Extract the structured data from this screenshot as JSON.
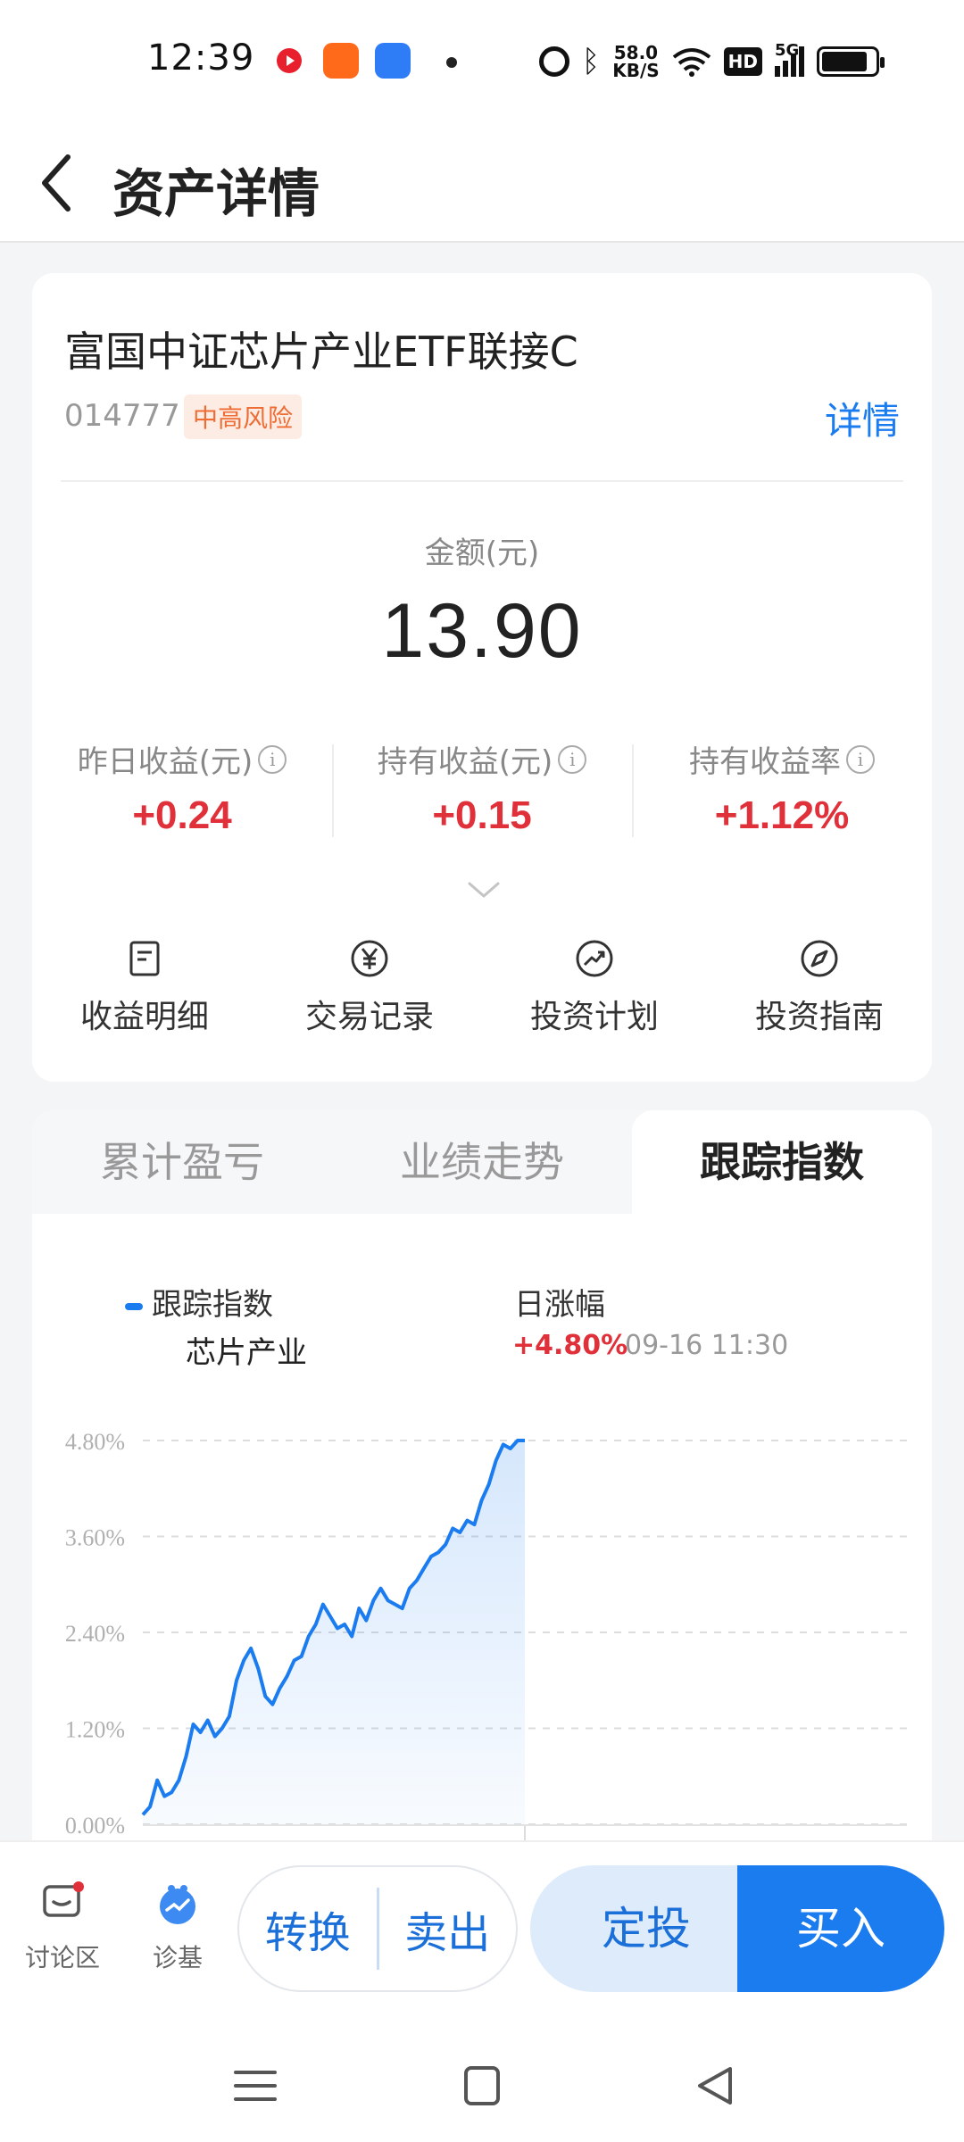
{
  "status_bar": {
    "time": "12:39",
    "net_speed_value": "58.0",
    "net_speed_unit": "KB/S",
    "hd": "HD",
    "signal": "5G",
    "icons": [
      "video-app-icon",
      "kuaishou-app-icon",
      "baidu-app-icon",
      "dot-icon",
      "alarm-icon",
      "bluetooth-icon",
      "wifi-icon",
      "hd-icon",
      "signal-icon",
      "battery-icon"
    ]
  },
  "header": {
    "title": "资产详情"
  },
  "fund": {
    "name": "富国中证芯片产业ETF联接C",
    "code": "014777",
    "risk": "中高风险",
    "detail_link": "详情",
    "amount_label": "金额(元)",
    "amount_value": "13.90"
  },
  "stats": [
    {
      "label": "昨日收益(元)",
      "value": "+0.24"
    },
    {
      "label": "持有收益(元)",
      "value": "+0.15"
    },
    {
      "label": "持有收益率",
      "value": "+1.12%"
    }
  ],
  "actions": [
    {
      "label": "收益明细",
      "icon": "document-icon"
    },
    {
      "label": "交易记录",
      "icon": "yuan-icon"
    },
    {
      "label": "投资计划",
      "icon": "trend-icon"
    },
    {
      "label": "投资指南",
      "icon": "compass-icon"
    }
  ],
  "tabs": [
    {
      "label": "累计盈亏",
      "active": false
    },
    {
      "label": "业绩走势",
      "active": false
    },
    {
      "label": "跟踪指数",
      "active": true
    }
  ],
  "chart_legend": {
    "series_title": "跟踪指数",
    "series_name": "芯片产业",
    "daily_label": "日涨幅",
    "daily_value": "+4.80%",
    "daily_time": "09-16 11:30"
  },
  "chart_data": {
    "type": "line",
    "ylim": [
      0,
      4.8
    ],
    "yticks": [
      "0.00%",
      "1.20%",
      "2.40%",
      "3.60%",
      "4.80%"
    ],
    "grid": true,
    "x": [
      0,
      2,
      4,
      6,
      8,
      10,
      12,
      14,
      16,
      18,
      20,
      22,
      24,
      26,
      28,
      30,
      32,
      34,
      36,
      38,
      40,
      42,
      44,
      46,
      48,
      50,
      52,
      54,
      56,
      58,
      60,
      62,
      64,
      66,
      68,
      70,
      72,
      74,
      76,
      78,
      80,
      82,
      84,
      86,
      88,
      90,
      92,
      94,
      96,
      98,
      100,
      102,
      104,
      106,
      108,
      110,
      112,
      114,
      116,
      118,
      120
    ],
    "values": [
      0.12,
      0.22,
      0.55,
      0.35,
      0.4,
      0.55,
      0.85,
      1.25,
      1.15,
      1.3,
      1.1,
      1.2,
      1.35,
      1.8,
      2.05,
      2.2,
      1.95,
      1.6,
      1.5,
      1.7,
      1.85,
      2.05,
      2.1,
      2.35,
      2.5,
      2.75,
      2.6,
      2.45,
      2.5,
      2.35,
      2.7,
      2.55,
      2.8,
      2.95,
      2.8,
      2.75,
      2.7,
      2.95,
      3.05,
      3.2,
      3.35,
      3.4,
      3.5,
      3.7,
      3.65,
      3.8,
      3.75,
      4.05,
      4.25,
      4.55,
      4.75,
      4.7,
      4.8,
      4.8
    ],
    "x_end_of_session": 240,
    "area_fill": true
  },
  "bottom": {
    "discuss": "讨论区",
    "diagnose": "诊基",
    "convert": "转换",
    "sell": "卖出",
    "plan": "定投",
    "buy": "买入"
  },
  "colors": {
    "accent": "#1b7cf0",
    "gain": "#e0303a",
    "risk_text": "#ee6d35"
  }
}
